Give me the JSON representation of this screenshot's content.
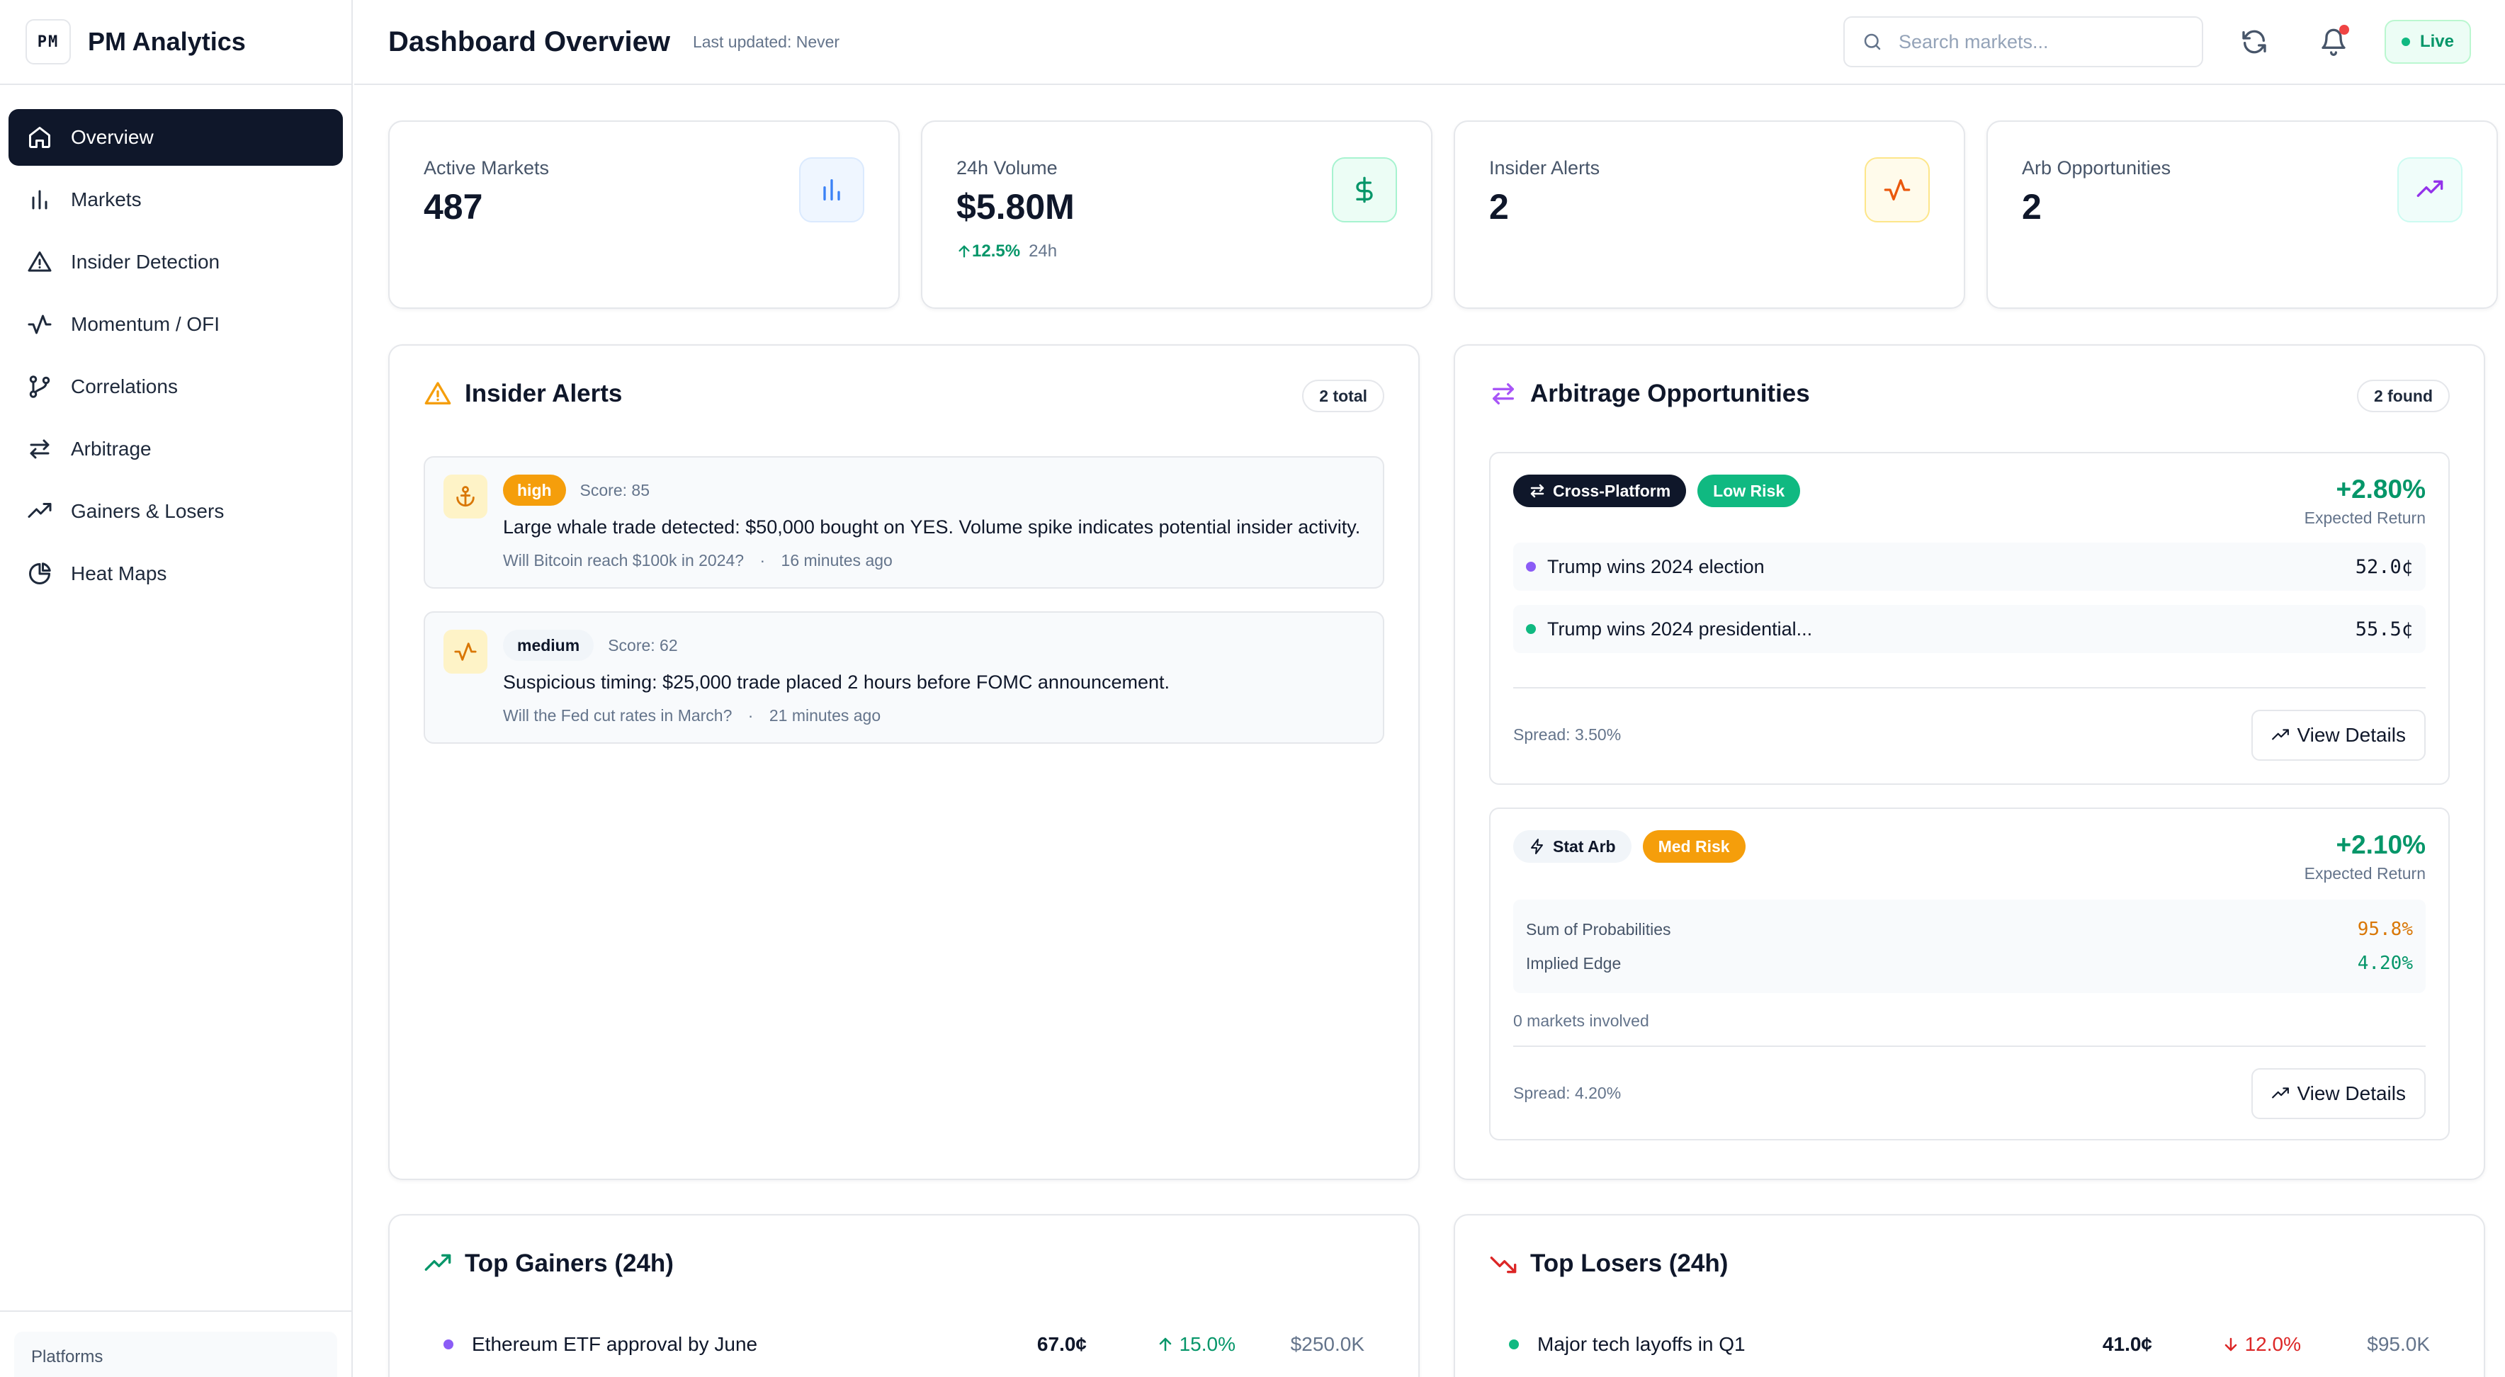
{
  "brand": {
    "logo": "PM",
    "name": "PM Analytics"
  },
  "nav": [
    {
      "label": "Overview",
      "icon": "home-icon",
      "active": true
    },
    {
      "label": "Markets",
      "icon": "bar-chart-icon"
    },
    {
      "label": "Insider Detection",
      "icon": "warning-icon"
    },
    {
      "label": "Momentum / OFI",
      "icon": "activity-icon"
    },
    {
      "label": "Correlations",
      "icon": "git-branch-icon"
    },
    {
      "label": "Arbitrage",
      "icon": "arrows-swap-icon"
    },
    {
      "label": "Gainers & Losers",
      "icon": "trending-up-icon"
    },
    {
      "label": "Heat Maps",
      "icon": "pie-chart-icon"
    }
  ],
  "sidebar_footer": {
    "platforms_label": "Platforms"
  },
  "header": {
    "title": "Dashboard Overview",
    "last_updated": "Last updated: Never",
    "search_placeholder": "Search markets...",
    "live_label": "Live"
  },
  "stats": [
    {
      "label": "Active Markets",
      "value": "487",
      "icon": "bar-chart-icon",
      "accent": "#3b82f6"
    },
    {
      "label": "24h Volume",
      "value": "$5.80M",
      "change": "12.5%",
      "change_period": "24h",
      "icon": "dollar-icon",
      "accent": "#059669"
    },
    {
      "label": "Insider Alerts",
      "value": "2",
      "icon": "activity-icon",
      "accent": "#ea580c"
    },
    {
      "label": "Arb Opportunities",
      "value": "2",
      "icon": "trending-up-icon",
      "accent": "#9333ea"
    }
  ],
  "insider": {
    "title": "Insider Alerts",
    "count": "2 total",
    "alerts": [
      {
        "severity": "high",
        "score": "Score: 85",
        "text": "Large whale trade detected: $50,000 bought on YES. Volume spike indicates potential insider activity.",
        "market": "Will Bitcoin reach $100k in 2024?",
        "time": "16 minutes ago",
        "icon": "anchor-icon"
      },
      {
        "severity": "medium",
        "score": "Score: 62",
        "text": "Suspicious timing: $25,000 trade placed 2 hours before FOMC announcement.",
        "market": "Will the Fed cut rates in March?",
        "time": "21 minutes ago",
        "icon": "activity-icon"
      }
    ]
  },
  "arbitrage": {
    "title": "Arbitrage Opportunities",
    "count": "2 found",
    "items": [
      {
        "type": "Cross-Platform",
        "risk": "Low Risk",
        "return": "+2.80%",
        "return_label": "Expected Return",
        "rows": [
          {
            "name": "Trump wins 2024 election",
            "price": "52.0¢",
            "color": "#8b5cf6"
          },
          {
            "name": "Trump wins 2024 presidential...",
            "price": "55.5¢",
            "color": "#10b981"
          }
        ],
        "spread": "Spread: 3.50%",
        "button": "View Details"
      },
      {
        "type": "Stat Arb",
        "risk": "Med Risk",
        "return": "+2.10%",
        "return_label": "Expected Return",
        "stats": [
          {
            "label": "Sum of Probabilities",
            "value": "95.8%",
            "color": "#d97706"
          },
          {
            "label": "Implied Edge",
            "value": "4.20%",
            "color": "#059669"
          }
        ],
        "markets_involved": "0 markets involved",
        "spread": "Spread: 4.20%",
        "button": "View Details"
      }
    ]
  },
  "gainers": {
    "title": "Top Gainers (24h)",
    "rows": [
      {
        "name": "Ethereum ETF approval by June",
        "price": "67.0¢",
        "change": "15.0%",
        "volume": "$250.0K",
        "color": "#8b5cf6"
      }
    ]
  },
  "losers": {
    "title": "Top Losers (24h)",
    "rows": [
      {
        "name": "Major tech layoffs in Q1",
        "price": "41.0¢",
        "change": "12.0%",
        "volume": "$95.0K",
        "color": "#10b981"
      }
    ]
  }
}
